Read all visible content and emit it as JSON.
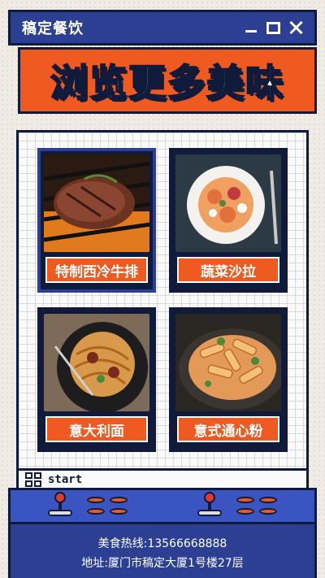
{
  "window": {
    "brand": "稿定餐饮"
  },
  "banner": {
    "title": "浏览更多美味"
  },
  "cards": [
    {
      "label": "特制西冷牛排"
    },
    {
      "label": "蔬菜沙拉"
    },
    {
      "label": "意大利面"
    },
    {
      "label": "意式通心粉"
    }
  ],
  "start_bar": {
    "label": "start"
  },
  "footer": {
    "hotline": "美食热线:13566668888",
    "address": "地址:厦门市稿定大厦1号楼27层"
  },
  "colors": {
    "accent": "#ee5a1f",
    "brand": "#2c3f93",
    "ink": "#101a3a"
  }
}
